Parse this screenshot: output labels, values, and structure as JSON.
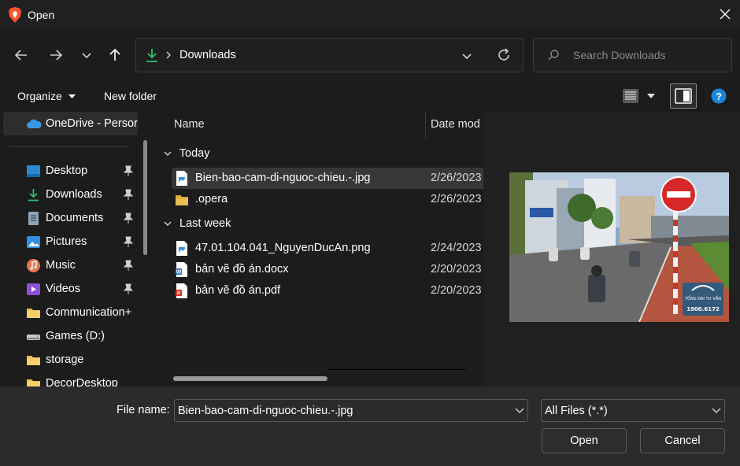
{
  "window": {
    "title": "Open",
    "accent": "#0078d4"
  },
  "nav": {
    "path_segment": "Downloads",
    "search_placeholder": "Search Downloads"
  },
  "toolbar": {
    "organize_label": "Organize",
    "new_folder_label": "New folder"
  },
  "sidebar": {
    "onedrive": "OneDrive - Persor",
    "items": [
      {
        "label": "Desktop",
        "icon": "desktop-icon",
        "pinned": true
      },
      {
        "label": "Downloads",
        "icon": "download-icon",
        "pinned": true
      },
      {
        "label": "Documents",
        "icon": "documents-icon",
        "pinned": true
      },
      {
        "label": "Pictures",
        "icon": "pictures-icon",
        "pinned": true
      },
      {
        "label": "Music",
        "icon": "music-icon",
        "pinned": true
      },
      {
        "label": "Videos",
        "icon": "videos-icon",
        "pinned": true
      },
      {
        "label": "Communication+",
        "icon": "folder-icon",
        "pinned": false
      },
      {
        "label": "Games (D:)",
        "icon": "drive-icon",
        "pinned": false
      },
      {
        "label": "storage",
        "icon": "folder-icon",
        "pinned": false
      },
      {
        "label": "DecorDesktop",
        "icon": "folder-icon",
        "pinned": false
      }
    ]
  },
  "files": {
    "columns": {
      "name": "Name",
      "date": "Date mod"
    },
    "groups": [
      {
        "label": "Today",
        "items": [
          {
            "name": "Bien-bao-cam-di-nguoc-chieu.-.jpg",
            "date": "2/26/2023",
            "type": "image",
            "selected": true
          },
          {
            "name": ".opera",
            "date": "2/26/2023",
            "type": "folder",
            "selected": false
          }
        ]
      },
      {
        "label": "Last week",
        "items": [
          {
            "name": "47.01.104.041_NguyenDucAn.png",
            "date": "2/24/2023",
            "type": "image",
            "selected": false
          },
          {
            "name": "bản vẽ đồ án.docx",
            "date": "2/20/2023",
            "type": "word",
            "selected": false
          },
          {
            "name": "bản vẽ đồ án.pdf",
            "date": "2/20/2023",
            "type": "pdf",
            "selected": false
          }
        ]
      }
    ]
  },
  "preview": {
    "sign_text": "TỔNG ĐÀI TƯ VẤN",
    "phone": "1900.6172"
  },
  "footer": {
    "file_name_label": "File name:",
    "file_name_value": "Bien-bao-cam-di-nguoc-chieu.-.jpg",
    "filter_value": "All Files (*.*)",
    "open_label": "Open",
    "cancel_label": "Cancel"
  }
}
